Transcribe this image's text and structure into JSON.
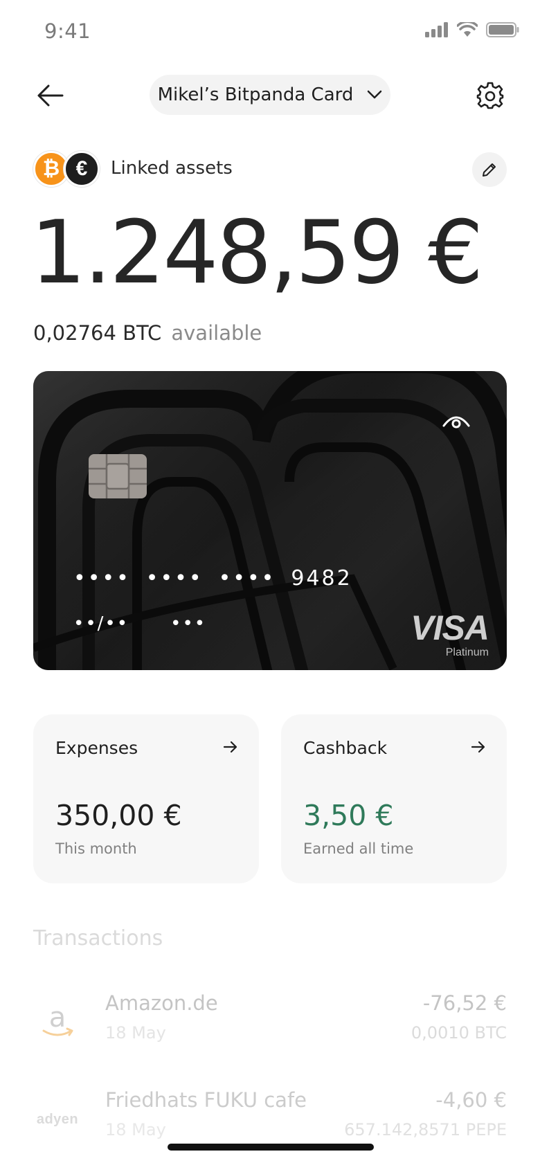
{
  "status_bar": {
    "time": "9:41"
  },
  "header": {
    "card_selector_label": "Mikel’s Bitpanda Card"
  },
  "linked_assets": {
    "label": "Linked assets",
    "coins": [
      "bitcoin-icon",
      "euro-icon"
    ]
  },
  "balance": {
    "fiat": "1.248,59 €",
    "crypto_amount": "0,02764 BTC",
    "crypto_suffix": "available"
  },
  "card": {
    "number_groups": [
      "••••",
      "••••",
      "••••",
      "9482"
    ],
    "expiry": "••/••",
    "cvv": "•••",
    "network": "VISA",
    "tier": "Platinum"
  },
  "tiles": {
    "expenses": {
      "title": "Expenses",
      "value": "350,00 €",
      "subtitle": "This month"
    },
    "cashback": {
      "title": "Cashback",
      "value": "3,50 €",
      "subtitle": "Earned all time",
      "color": "#2f7a5a"
    }
  },
  "transactions": {
    "heading": "Transactions",
    "items": [
      {
        "merchant": "Amazon.de",
        "date": "18 May",
        "amount": "-76,52 €",
        "crypto": "0,0010 BTC",
        "logo": "amazon-logo"
      },
      {
        "merchant": "Friedhats FUKU cafe",
        "date": "18 May",
        "amount": "-4,60 €",
        "crypto": "657.142,8571 PEPE",
        "logo": "adyen-logo",
        "logo_text": "adyen"
      }
    ]
  },
  "colors": {
    "bitcoin": "#f7931a",
    "accent_green": "#2f7a5a",
    "card_bg": "#1e1e1e"
  }
}
